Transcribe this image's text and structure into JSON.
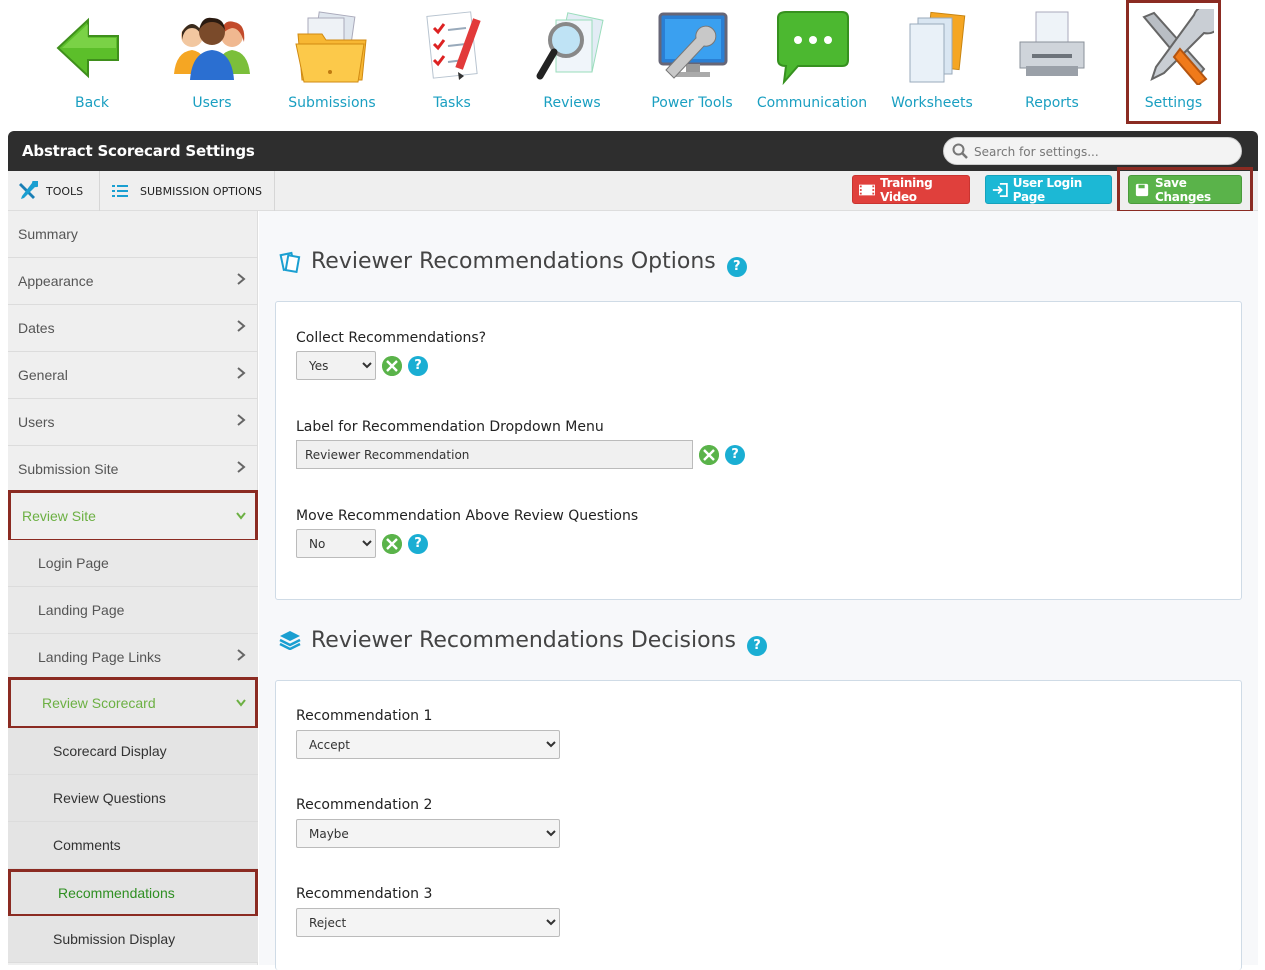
{
  "topnav": [
    {
      "label": "Back",
      "icon": "back-arrow-icon"
    },
    {
      "label": "Users",
      "icon": "users-icon"
    },
    {
      "label": "Submissions",
      "icon": "folder-icon"
    },
    {
      "label": "Tasks",
      "icon": "checklist-icon"
    },
    {
      "label": "Reviews",
      "icon": "magnifier-icon"
    },
    {
      "label": "Power Tools",
      "icon": "monitor-wrench-icon"
    },
    {
      "label": "Communication",
      "icon": "chat-bubble-icon"
    },
    {
      "label": "Worksheets",
      "icon": "documents-icon"
    },
    {
      "label": "Reports",
      "icon": "printer-icon"
    },
    {
      "label": "Settings",
      "icon": "tools-icon"
    }
  ],
  "header": {
    "title": "Abstract Scorecard Settings",
    "search_placeholder": "Search for settings..."
  },
  "toolbar": {
    "tools_label": "TOOLS",
    "submission_options_label": "SUBMISSION OPTIONS",
    "training_video": "Training Video",
    "user_login_page": "User Login Page",
    "save_changes": "Save Changes"
  },
  "sidebar": {
    "items": [
      {
        "label": "Summary"
      },
      {
        "label": "Appearance"
      },
      {
        "label": "Dates"
      },
      {
        "label": "General"
      },
      {
        "label": "Users"
      },
      {
        "label": "Submission Site"
      },
      {
        "label": "Review Site"
      },
      {
        "label": "Login Page"
      },
      {
        "label": "Landing Page"
      },
      {
        "label": "Landing Page Links"
      },
      {
        "label": "Review Scorecard"
      },
      {
        "label": "Scorecard Display"
      },
      {
        "label": "Review Questions"
      },
      {
        "label": "Comments"
      },
      {
        "label": "Recommendations"
      },
      {
        "label": "Submission Display"
      }
    ]
  },
  "options": {
    "title": "Reviewer Recommendations Options",
    "collect_label": "Collect Recommendations?",
    "collect_value": "Yes",
    "dropdown_label": "Label for Recommendation Dropdown Menu",
    "dropdown_value": "Reviewer Recommendation",
    "move_label": "Move Recommendation Above Review Questions",
    "move_value": "No"
  },
  "decisions": {
    "title": "Reviewer Recommendations Decisions",
    "rec1_label": "Recommendation 1",
    "rec1_value": "Accept",
    "rec2_label": "Recommendation 2",
    "rec2_value": "Maybe",
    "rec3_label": "Recommendation 3",
    "rec3_value": "Reject"
  },
  "help_glyph": "?",
  "colors": {
    "accent_teal": "#1aaed3",
    "nav_label": "#1a9fc1",
    "highlight_box": "#8b2b22",
    "save_green": "#5ab34a",
    "training_red": "#e0403c",
    "active_green": "#6cb043"
  }
}
